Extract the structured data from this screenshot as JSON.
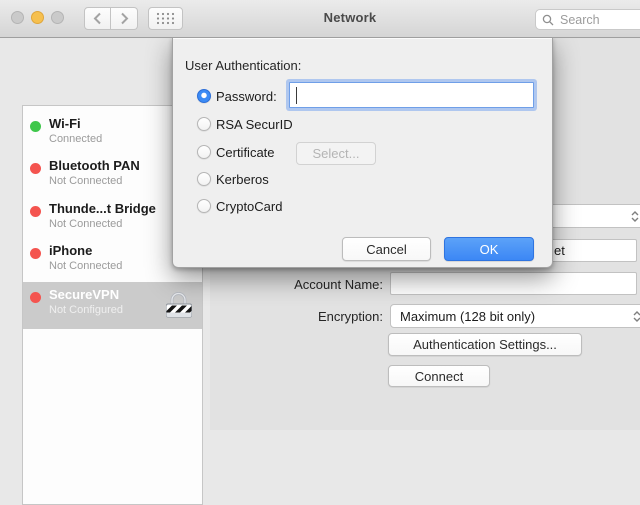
{
  "titlebar": {
    "title": "Network",
    "search_placeholder": "Search",
    "traffic_lights": [
      {
        "name": "close",
        "state": "disabled-gray"
      },
      {
        "name": "minimize",
        "state": "yellow"
      },
      {
        "name": "zoom",
        "state": "disabled-gray"
      }
    ]
  },
  "icons": {
    "back": "chevron-left",
    "forward": "chevron-right",
    "show_all": "app-grid-dots",
    "search": "magnifier",
    "vpn": "padlock-with-diagonal-stripes",
    "popup_indicator": "up-down-chevrons"
  },
  "sidebar": {
    "items": [
      {
        "name": "Wi-Fi",
        "status": "Connected",
        "dot": "green",
        "selected": false
      },
      {
        "name": "Bluetooth PAN",
        "status": "Not Connected",
        "dot": "red",
        "selected": false
      },
      {
        "name": "Thunde...t Bridge",
        "status": "Not Connected",
        "dot": "red",
        "selected": false
      },
      {
        "name": "iPhone",
        "status": "Not Connected",
        "dot": "red",
        "selected": false
      },
      {
        "name": "SecureVPN",
        "status": "Not Configured",
        "dot": "red",
        "selected": true,
        "icon": "vpn-lock"
      }
    ]
  },
  "dialog": {
    "title": "User Authentication:",
    "options": [
      {
        "label": "Password:",
        "selected": true,
        "field_value": ""
      },
      {
        "label": "RSA SecurID",
        "selected": false
      },
      {
        "label": "Certificate",
        "selected": false,
        "button_label": "Select...",
        "button_enabled": false
      },
      {
        "label": "Kerberos",
        "selected": false
      },
      {
        "label": "CryptoCard",
        "selected": false
      }
    ],
    "cancel_label": "Cancel",
    "ok_label": "OK"
  },
  "main": {
    "server_field_visible_text": "et",
    "account_name_label": "Account Name:",
    "account_name_value": "",
    "encryption_label": "Encryption:",
    "encryption_value": "Maximum (128 bit only)",
    "auth_settings_label": "Authentication Settings...",
    "connect_label": "Connect"
  },
  "colors": {
    "ok_blue": "#3c87f5",
    "radio_blue": "#3b8bf5",
    "status_green": "#3fc74b",
    "status_red": "#f4544f",
    "minimize_yellow": "#f6c04f",
    "focus_ring": "rgba(112,160,240,0.5)"
  }
}
